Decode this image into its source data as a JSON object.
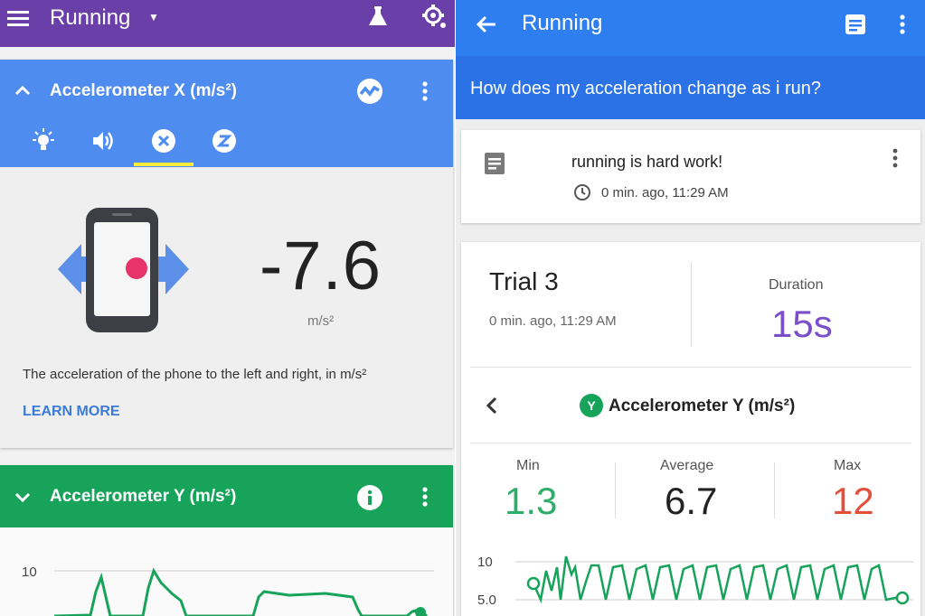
{
  "left": {
    "appbar": {
      "title": "Running"
    },
    "accel_x": {
      "title": "Accelerometer X (m/s²)",
      "reading": "-7.6",
      "unit": "m/s²",
      "description": "The acceleration of the phone to the left and right, in m/s²",
      "learn_more": "LEARN MORE",
      "tabs": [
        "brightness-icon",
        "sound-icon",
        "accelerometer-x-icon",
        "accelerometer-z-icon"
      ],
      "active_tab": 2
    },
    "accel_y": {
      "title": "Accelerometer Y (m/s²)",
      "y_tick": "10"
    }
  },
  "right": {
    "appbar": {
      "title": "Running"
    },
    "question": "How does my acceleration change as i run?",
    "note": {
      "text": "running is hard work!",
      "time": "0 min. ago, 11:29 AM"
    },
    "trial": {
      "name": "Trial 3",
      "time": "0 min. ago, 11:29 AM",
      "duration_label": "Duration",
      "duration": "15s",
      "sensor_badge": "Y",
      "sensor_title": "Accelerometer Y (m/s²)",
      "stats": [
        {
          "label": "Min",
          "value": "1.3",
          "color": "#2fae6a"
        },
        {
          "label": "Average",
          "value": "6.7",
          "color": "#222222"
        },
        {
          "label": "Max",
          "value": "12",
          "color": "#e2503c"
        }
      ],
      "y_ticks": [
        "10",
        "5.0"
      ]
    }
  },
  "colors": {
    "left_appbar": "#6a3fa8",
    "sensor_blue": "#4f8cf0",
    "sensor_green": "#17a35a",
    "right_appbar": "#2f7ef0",
    "tab_indicator": "#ffeb3b",
    "duration_purple": "#7b4fc9"
  }
}
